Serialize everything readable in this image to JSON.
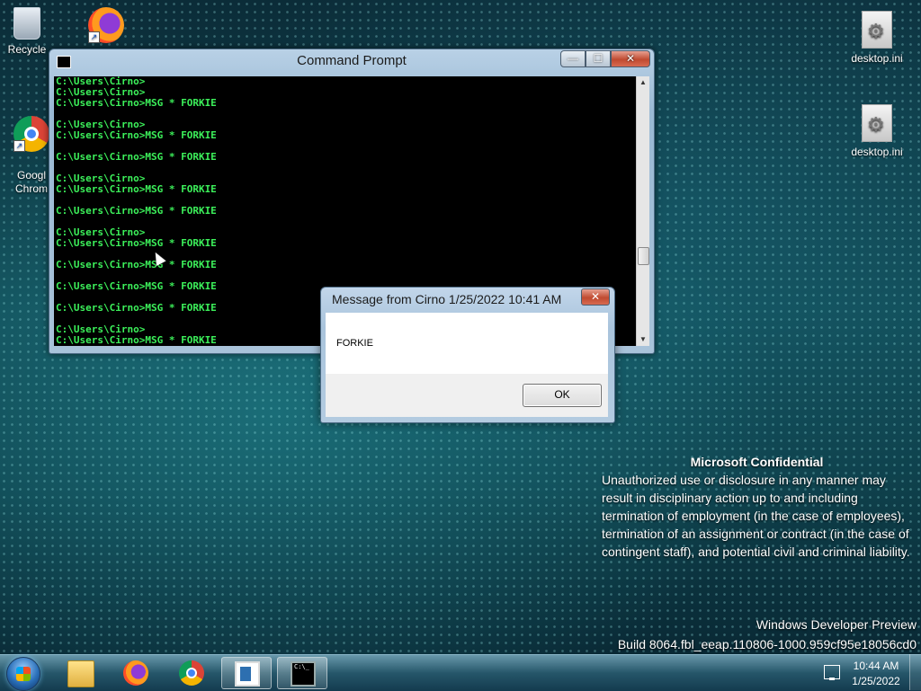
{
  "desktop": {
    "icons": [
      {
        "label": "Recycle"
      },
      {
        "label": ""
      },
      {
        "label": "Googl\nChrom"
      },
      {
        "label": "desktop.ini"
      },
      {
        "label": "desktop.ini"
      }
    ]
  },
  "cmd_window": {
    "title": "Command Prompt",
    "buttons": {
      "minimize": "—",
      "maximize": "☐",
      "close": "✕"
    },
    "lines": [
      "C:\\Users\\Cirno>",
      "C:\\Users\\Cirno>",
      "C:\\Users\\Cirno>MSG * FORKIE",
      "",
      "C:\\Users\\Cirno>",
      "C:\\Users\\Cirno>MSG * FORKIE",
      "",
      "C:\\Users\\Cirno>MSG * FORKIE",
      "",
      "C:\\Users\\Cirno>",
      "C:\\Users\\Cirno>MSG * FORKIE",
      "",
      "C:\\Users\\Cirno>MSG * FORKIE",
      "",
      "C:\\Users\\Cirno>",
      "C:\\Users\\Cirno>MSG * FORKIE",
      "",
      "C:\\Users\\Cirno>MSG * FORKIE",
      "",
      "C:\\Users\\Cirno>MSG * FORKIE",
      "",
      "C:\\Users\\Cirno>MSG * FORKIE",
      "",
      "C:\\Users\\Cirno>",
      "C:\\Users\\Cirno>MSG * FORKIE"
    ]
  },
  "message_dialog": {
    "title": "Message from Cirno 1/25/2022 10:41 AM",
    "close": "✕",
    "message": "FORKIE",
    "ok_label": "OK"
  },
  "confidential": {
    "heading": "Microsoft Confidential",
    "body": "Unauthorized use or disclosure in any manner may result in disciplinary action up to and including termination of employment (in the case of employees), termination of an assignment or contract (in the case of contingent staff), and potential civil and criminal liability."
  },
  "build": {
    "line1": "Windows Developer Preview",
    "line2": "Build 8064.fbl_eeap.110806-1000.959cf95e18056cd0"
  },
  "taskbar": {
    "cmd_icon_text": "C:\\_",
    "clock_time": "10:44 AM",
    "clock_date": "1/25/2022"
  },
  "colors": {
    "console_text": "#3cf05a",
    "console_bg": "#000000",
    "window_chrome": "#a9c3da"
  }
}
